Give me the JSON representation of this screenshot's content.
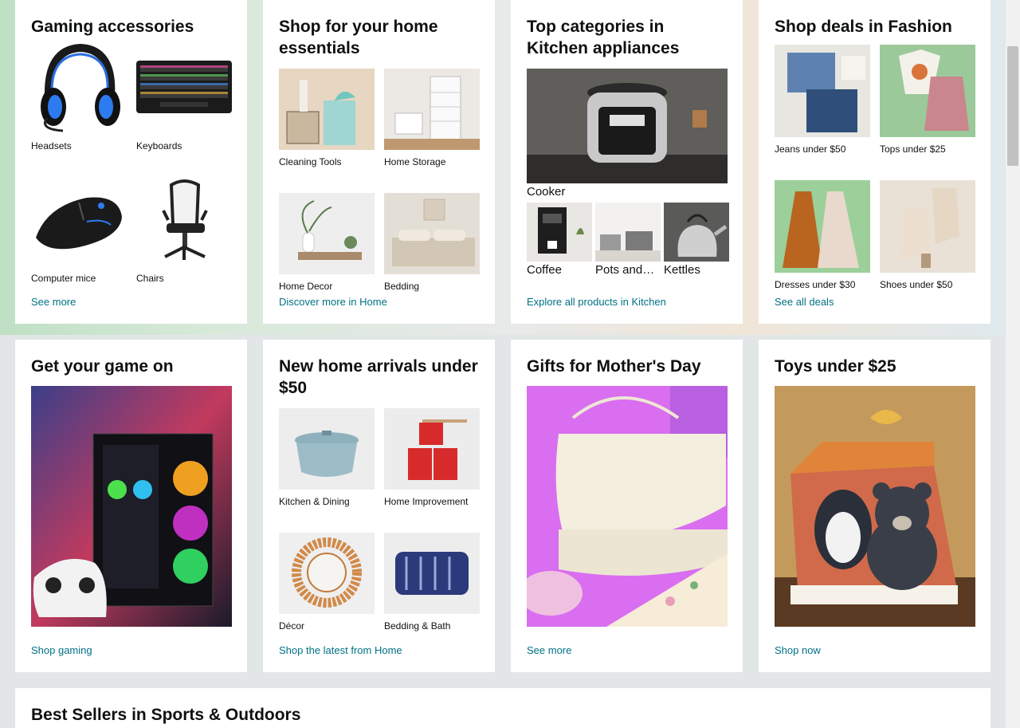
{
  "cards": {
    "gaming_accessories": {
      "title": "Gaming accessories",
      "items": [
        "Headsets",
        "Keyboards",
        "Computer mice",
        "Chairs"
      ],
      "link": "See more"
    },
    "home_essentials": {
      "title": "Shop for your home essentials",
      "items": [
        "Cleaning Tools",
        "Home Storage",
        "Home Decor",
        "Bedding"
      ],
      "link": "Discover more in Home"
    },
    "kitchen": {
      "title": "Top categories in Kitchen appliances",
      "main_item": "Cooker",
      "items": [
        "Coffee",
        "Pots and…",
        "Kettles"
      ],
      "link": "Explore all products in Kitchen"
    },
    "fashion": {
      "title": "Shop deals in Fashion",
      "items": [
        "Jeans under $50",
        "Tops under $25",
        "Dresses under $30",
        "Shoes under $50"
      ],
      "link": "See all deals"
    },
    "game_on": {
      "title": "Get your game on",
      "link": "Shop gaming"
    },
    "home_arrivals": {
      "title": "New home arrivals under $50",
      "items": [
        "Kitchen & Dining",
        "Home Improvement",
        "Décor",
        "Bedding & Bath"
      ],
      "link": "Shop the latest from Home"
    },
    "mothers_day": {
      "title": "Gifts for Mother's Day",
      "link": "See more"
    },
    "toys": {
      "title": "Toys under $25",
      "link": "Shop now"
    }
  },
  "best_sellers": {
    "title": "Best Sellers in Sports & Outdoors"
  },
  "colors": {
    "link": "#007185",
    "text": "#0f1111",
    "page_bg": "#e3e6e6"
  }
}
